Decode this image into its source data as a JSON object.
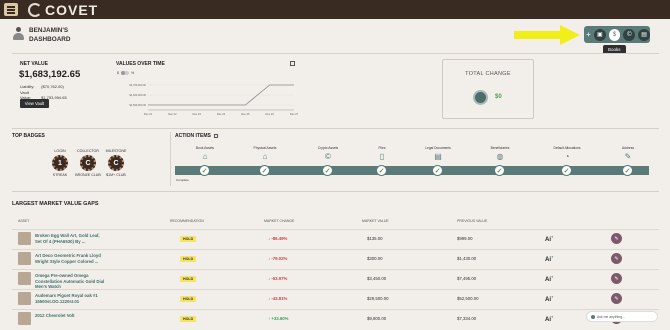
{
  "app": {
    "logo_text": "COVET"
  },
  "header": {
    "dashboard_title": "BENJAMIN'S DASHBOARD",
    "tooltip": "Books"
  },
  "net_value": {
    "title": "NET VALUE",
    "value": "$1,683,192.65",
    "liability_label": "Liability:",
    "liability_value": "($70,762.00)",
    "vault_label": "Vault Value:",
    "vault_value": "$1,753,954.65",
    "view_vault_button": "View Vault"
  },
  "values_over_time": {
    "title": "VALUES OVER TIME",
    "toggle_left": "$",
    "toggle_right": "%"
  },
  "chart_data": {
    "type": "line",
    "x": [
      "Dec 21",
      "Dec 22",
      "Dec 23",
      "Dec 24",
      "Dec 25",
      "Dec 26",
      "Dec 27"
    ],
    "series": [
      {
        "values": [
          1500000,
          1500000,
          1500000,
          1500000,
          1500000,
          1700000,
          1700000
        ]
      }
    ],
    "yticks": [
      "$1,700,000.00",
      "$1,600,000.00",
      "$1,500,000.00"
    ],
    "ylim": [
      1450000,
      1750000
    ],
    "color": "#8a8a8a"
  },
  "total_change": {
    "title": "TOTAL CHANGE",
    "value": "$0"
  },
  "top_badges": {
    "title": "TOP BADGES",
    "items": [
      {
        "top": "LOGIN",
        "bottom": "STREAK",
        "glyph": "1"
      },
      {
        "top": "COLLECTOR",
        "bottom": "BRONZE CLUB",
        "glyph": "C"
      },
      {
        "top": "MILESTONE",
        "bottom": "$1M+ CLUB",
        "glyph": "C"
      }
    ]
  },
  "action_items": {
    "title": "ACTION ITEMS",
    "items": [
      "Book Assets",
      "Physical Assets",
      "Crypto Assets",
      "Files",
      "Legal Documents",
      "Beneficiaries",
      "Default Allocations",
      "Address"
    ],
    "complete_label": "Complete"
  },
  "gaps": {
    "title": "LARGEST MARKET VALUE GAPS",
    "columns": [
      "ASSET",
      "RECOMMENDATION",
      "MARKET CHANGE",
      "MARKET VALUE",
      "PREVIOUS VALUE"
    ],
    "ai_label": "Ai",
    "rows": [
      {
        "name": "Broken Egg Wall Art, Gold Leaf, Set Of 4 (PHA6530) By ...",
        "rec": "HOLD",
        "change": "↓ -86.49%",
        "mv": "$135.00",
        "pv": "$999.00",
        "dir": "down"
      },
      {
        "name": "Art Deco Geometric Frank Lloyd Wright Style Copper Colored ...",
        "rec": "HOLD",
        "change": "↓ -79.02%",
        "mv": "$300.00",
        "pv": "$1,430.00",
        "dir": "down"
      },
      {
        "name": "Omega Pre-owned Omega Constellation Automatic Gold Dial Men's Watch",
        "rec": "HOLD",
        "change": "↓ -53.97%",
        "mv": "$3,450.00",
        "pv": "$7,495.00",
        "dir": "down"
      },
      {
        "name": "Audemars Piguet Royal oak #1 15500st.OO.1220st.01",
        "rec": "HOLD",
        "change": "↓ -43.81%",
        "mv": "$29,500.00",
        "pv": "$52,500.00",
        "dir": "down"
      },
      {
        "name": "2012 Chevrolet Volt",
        "rec": "HOLD",
        "change": "↑ +33.60%",
        "mv": "$9,800.00",
        "pv": "$7,334.00",
        "dir": "up"
      }
    ]
  },
  "chat": {
    "placeholder": "Ask me anything..."
  }
}
